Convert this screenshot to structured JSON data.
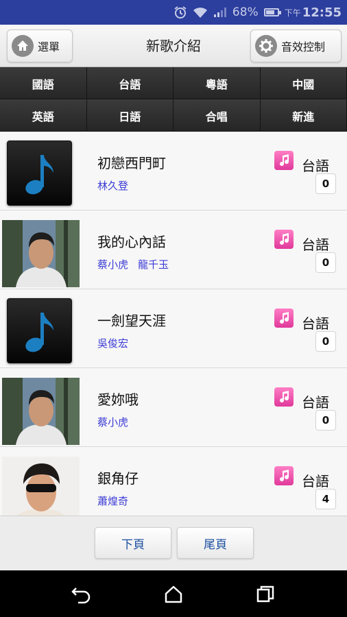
{
  "status_bar": {
    "battery": "68%",
    "ampm": "下午",
    "time": "12:55"
  },
  "header": {
    "menu_label": "選單",
    "title": "新歌介紹",
    "fx_label": "音效控制"
  },
  "categories": [
    "國語",
    "台語",
    "粵語",
    "中國",
    "英語",
    "日語",
    "合唱",
    "新進"
  ],
  "songs": [
    {
      "title": "初戀西門町",
      "artists": [
        "林久登"
      ],
      "lang": "台語",
      "count": "0",
      "thumb": "music-note-icon"
    },
    {
      "title": "我的心內話",
      "artists": [
        "蔡小虎",
        "龍千玉"
      ],
      "lang": "台語",
      "count": "0",
      "thumb": "artist-photo"
    },
    {
      "title": "一劍望天涯",
      "artists": [
        "吳俊宏"
      ],
      "lang": "台語",
      "count": "0",
      "thumb": "music-note-icon"
    },
    {
      "title": "愛妳哦",
      "artists": [
        "蔡小虎"
      ],
      "lang": "台語",
      "count": "0",
      "thumb": "artist-photo"
    },
    {
      "title": "銀角仔",
      "artists": [
        "蕭煌奇"
      ],
      "lang": "台語",
      "count": "4",
      "thumb": "artist-photo"
    }
  ],
  "pager": {
    "next_label": "下頁",
    "last_label": "尾頁"
  },
  "colors": {
    "status_bar": "#2c3e9e",
    "artist_link": "#3b3bd6",
    "note_icon": "#e0399b",
    "pager_text": "#1a4fa0"
  }
}
